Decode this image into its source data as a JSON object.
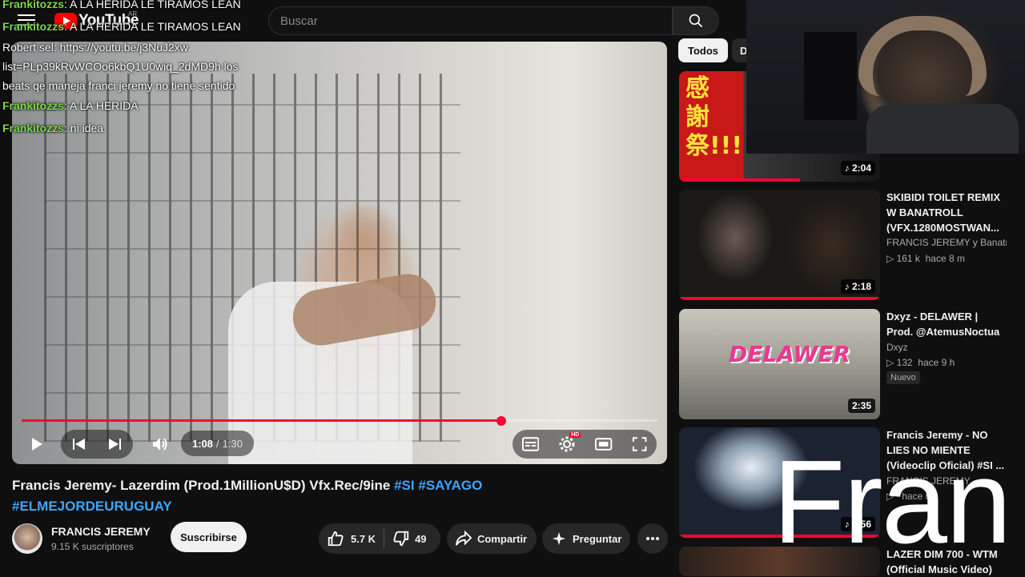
{
  "header": {
    "logo_text": "YouTube",
    "country_code": "AR",
    "search_placeholder": "Buscar"
  },
  "chat": [
    {
      "user": "Frankitozzs",
      "text": " A LA HERIDA LE TIRAMOS LEAN"
    },
    {
      "user": "Frankitozzs",
      "text": " A LA HERIDA LE TIRAMOS LEAN"
    },
    {
      "user": "Robert sel",
      "text": " https://youtu.be/j3NuJ2xw list=PLp39kRvWCOo6kbQ1U0wiq_2dMD9h los beats qe maneja franci jeremy no tiene sentido"
    },
    {
      "user": "Frankitozzs",
      "text": " A LA HERIDA"
    },
    {
      "user": "Frankitozzs",
      "text": " ni idea"
    }
  ],
  "player": {
    "current_time": "1:08",
    "separator": "/",
    "duration": "1:30",
    "progress": 0.755,
    "hd_badge": "HD"
  },
  "video": {
    "title": "Francis Jeremy- Lazerdim (Prod.1MillionU$D) Vfx.Rec/9ine ",
    "tags": [
      "#SI",
      "#SAYAGO",
      "#ELMEJORDEURUGUAY"
    ],
    "channel": "FRANCIS JEREMY",
    "subscribers": "9.15 K suscriptores",
    "subscribe_label": "Suscribirse",
    "likes": "5.7 K",
    "dislikes": "49",
    "share_label": "Compartir",
    "ask_label": "Preguntar"
  },
  "sidebar": {
    "chips": [
      "Todos",
      "De"
    ],
    "videos": [
      {
        "title": "",
        "channel": "",
        "views": "",
        "age": "",
        "duration": "2:04",
        "thumb_text": "感謝祭!!!",
        "progress": 0.6
      },
      {
        "title": "SKIBIDI TOILET REMIX W BANATROLL (VFX.1280MOSTWAN...",
        "channel": "FRANCIS JEREMY y Banatr...",
        "views": "161 k",
        "age": "hace 8 m",
        "duration": "2:18",
        "progress": 1.0
      },
      {
        "title": "Dxyz - DELAWER | Prod. @AtemusNoctua",
        "channel": "Dxyz",
        "views": "132",
        "age": "hace 9 h",
        "duration": "2:35",
        "badge": "Nuevo",
        "thumb_text": "DELAWER"
      },
      {
        "title": "Francis Jeremy - NO LIES NO MIENTE (Videoclip Oficial) #SI ...",
        "channel": "FRANCIS JEREMY",
        "views": "",
        "age": "hace m",
        "duration": "2:56",
        "progress": 1.0
      },
      {
        "title": "LAZER DIM 700 - WTM (Official Music Video)",
        "channel": "",
        "views": "",
        "age": "",
        "duration": ""
      }
    ]
  },
  "overlay_text": "Fran",
  "colors": {
    "accent_red": "#ff0033",
    "link_blue": "#3ea6ff",
    "chat_user_green": "#7cd94a",
    "background": "#0f0f0f"
  }
}
